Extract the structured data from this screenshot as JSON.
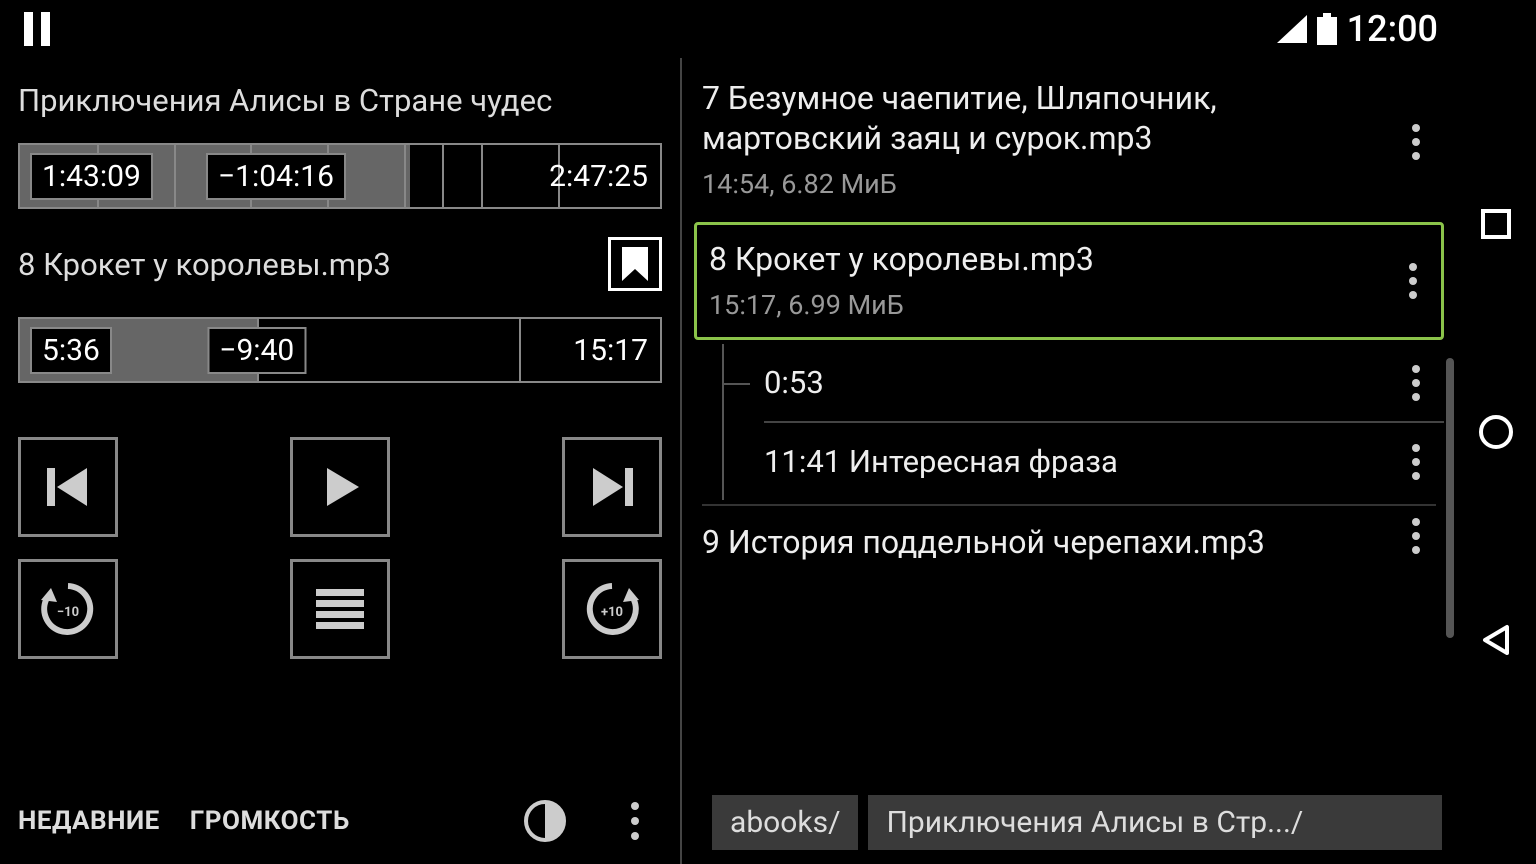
{
  "status": {
    "time": "12:00"
  },
  "player": {
    "book_title": "Приключения Алисы в Стране чудес",
    "book_progress": {
      "elapsed": "1:43:09",
      "remaining": "−1:04:16",
      "total": "2:47:25",
      "percent": 61
    },
    "track_name": "8 Крокет у королевы.mp3",
    "track_progress": {
      "elapsed": "5:36",
      "remaining": "−9:40",
      "total": "15:17",
      "percent": 37
    },
    "rewind_label": "−10",
    "forward_label": "+10"
  },
  "bottom_tabs": {
    "recent": "НЕДАВНИЕ",
    "volume": "ГРОМКОСТЬ"
  },
  "playlist": [
    {
      "title": "7 Безумное чаепитие, Шляпочник, мартовский заяц и сурок.mp3",
      "meta": "14:54, 6.82 МиБ",
      "active": false
    },
    {
      "title": "8 Крокет у королевы.mp3",
      "meta": "15:17, 6.99 МиБ",
      "active": true,
      "bookmarks": [
        {
          "label": "0:53"
        },
        {
          "label": "11:41 Интересная фраза"
        }
      ]
    },
    {
      "title": "9 История поддельной черепахи.mp3",
      "meta": "",
      "active": false
    }
  ],
  "breadcrumb": [
    "abooks/",
    "Приключения Алисы в Стр.../"
  ]
}
